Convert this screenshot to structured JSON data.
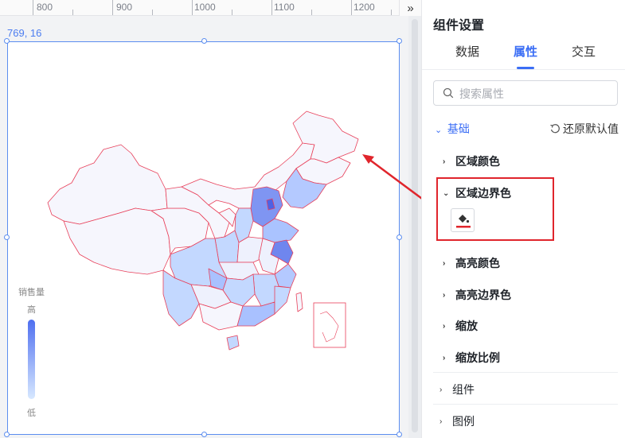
{
  "ruler": {
    "labels": [
      "800",
      "900",
      "1000",
      "1100",
      "1200"
    ],
    "collapse_icon": "double-chevron-right-icon"
  },
  "selection": {
    "coord": "769, 16"
  },
  "map": {
    "legend": {
      "title": "销售量",
      "high": "高",
      "low": "低",
      "color_high": "#4f6ff0",
      "color_low": "#d7e8ff"
    },
    "border_color": "#e8405a",
    "fill_base": "#f6f6fd"
  },
  "panel": {
    "title": "组件设置",
    "tabs": [
      {
        "label": "数据",
        "active": false
      },
      {
        "label": "属性",
        "active": true
      },
      {
        "label": "交互",
        "active": false
      }
    ],
    "search": {
      "placeholder": "搜索属性",
      "value": ""
    },
    "section": {
      "label": "基础",
      "restore_label": "还原默认值"
    },
    "props": [
      {
        "label": "区域颜色",
        "expanded": false
      },
      {
        "label": "区域边界色",
        "expanded": true
      },
      {
        "label": "高亮颜色",
        "expanded": false
      },
      {
        "label": "高亮边界色",
        "expanded": false
      },
      {
        "label": "缩放",
        "expanded": false
      },
      {
        "label": "缩放比例",
        "expanded": false
      }
    ],
    "groups": [
      {
        "label": "组件"
      },
      {
        "label": "图例"
      }
    ],
    "color_swatch": "#e0252c"
  },
  "annotation": {
    "color": "#e0252c"
  }
}
